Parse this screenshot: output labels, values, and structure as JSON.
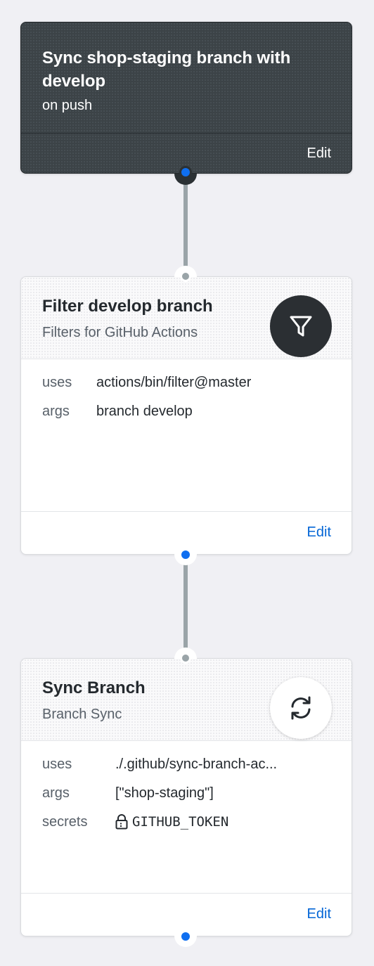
{
  "workflow": {
    "title": "Sync shop-staging branch with develop",
    "trigger": "on push",
    "edit_label": "Edit"
  },
  "actions": [
    {
      "title": "Filter develop branch",
      "subtitle": "Filters for GitHub Actions",
      "icon": "filter-icon",
      "fields": [
        {
          "key": "uses",
          "value": "actions/bin/filter@master"
        },
        {
          "key": "args",
          "value": "branch develop"
        }
      ],
      "edit_label": "Edit"
    },
    {
      "title": "Sync Branch",
      "subtitle": "Branch Sync",
      "icon": "sync-icon",
      "fields": [
        {
          "key": "uses",
          "value": "./.github/sync-branch-ac..."
        },
        {
          "key": "args",
          "value": "[\"shop-staging\"]"
        },
        {
          "key": "secrets",
          "value": "GITHUB_TOKEN"
        }
      ],
      "edit_label": "Edit"
    }
  ],
  "colors": {
    "accent": "#0366d6",
    "port_active": "#0f6ff0",
    "connector": "#9aa4a8",
    "trigger_bg": "#3c4347"
  }
}
